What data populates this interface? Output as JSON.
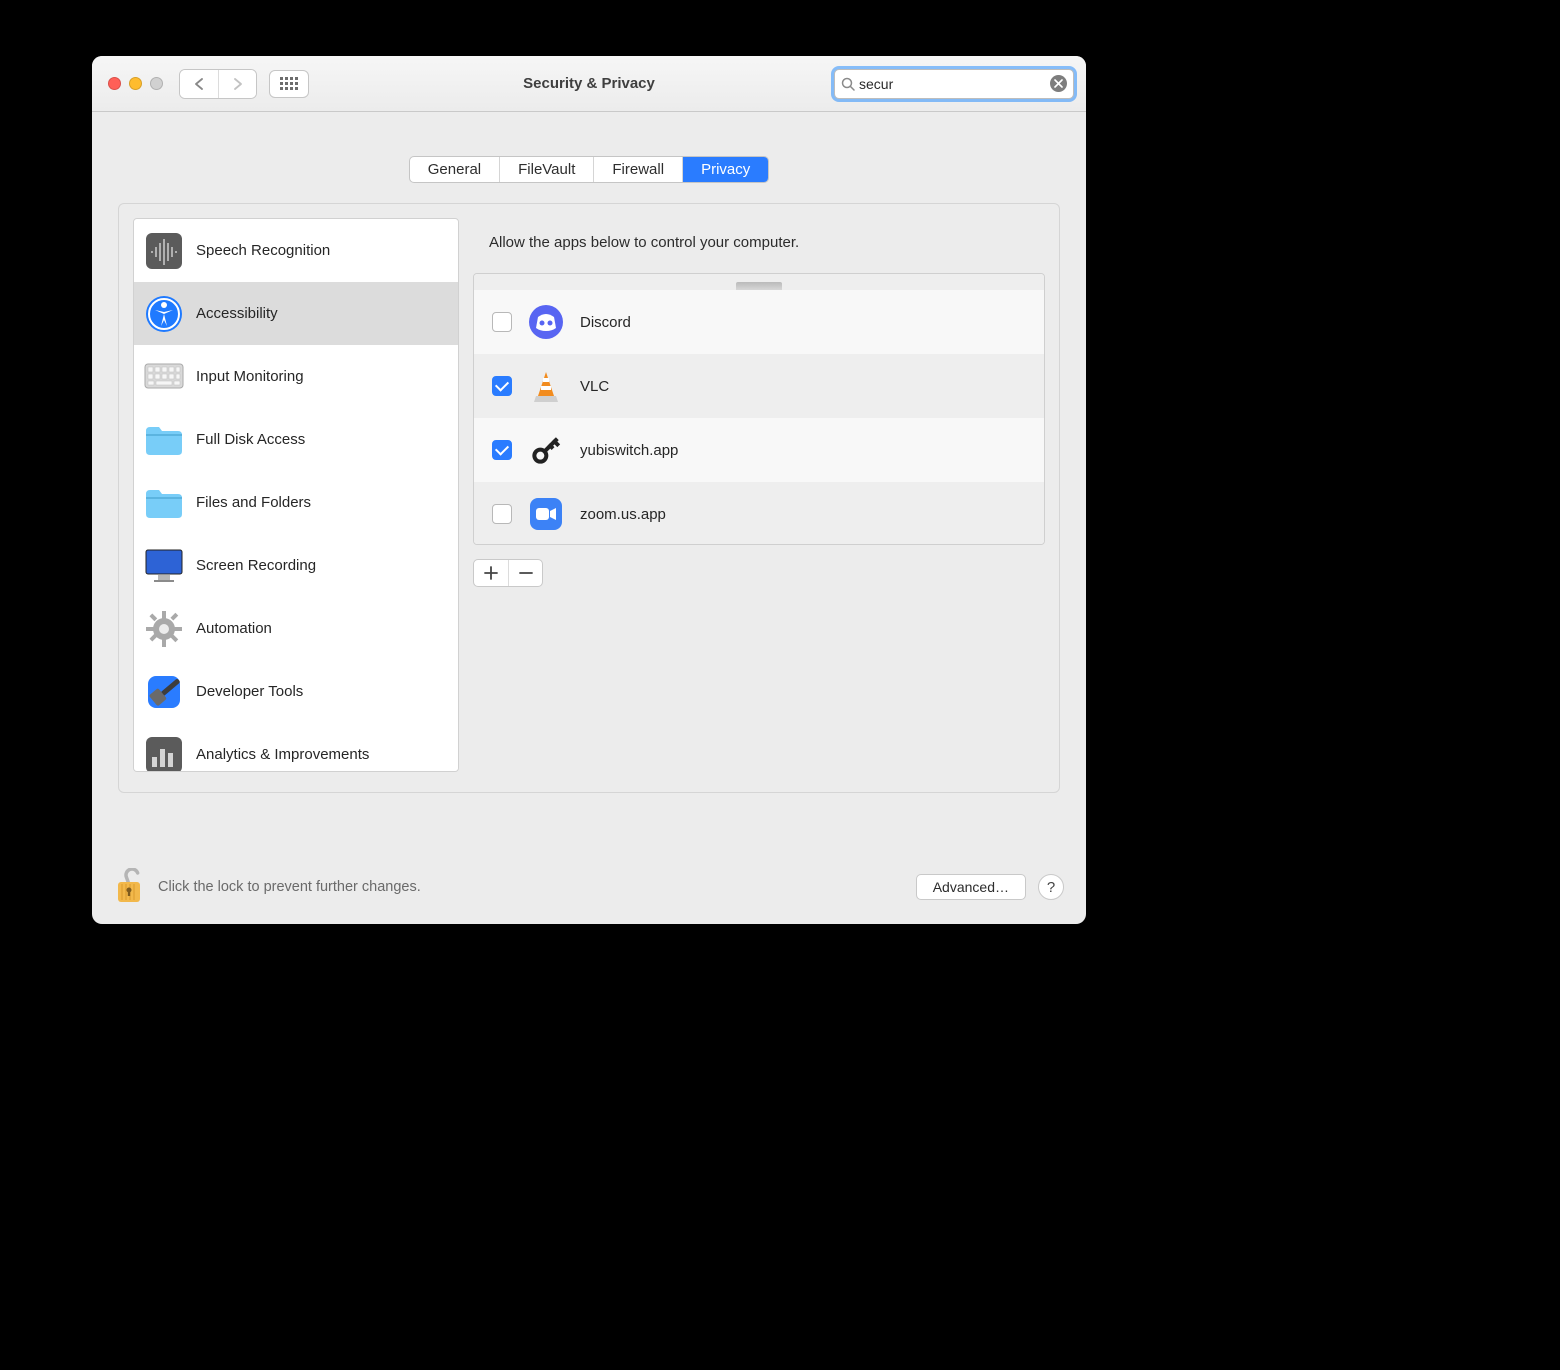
{
  "window": {
    "title": "Security & Privacy"
  },
  "search": {
    "value": "secur"
  },
  "tabs": [
    {
      "label": "General",
      "active": false
    },
    {
      "label": "FileVault",
      "active": false
    },
    {
      "label": "Firewall",
      "active": false
    },
    {
      "label": "Privacy",
      "active": true
    }
  ],
  "sidebar": {
    "items": [
      {
        "label": "Speech Recognition",
        "icon": "speech",
        "selected": false
      },
      {
        "label": "Accessibility",
        "icon": "accessibility",
        "selected": true
      },
      {
        "label": "Input Monitoring",
        "icon": "keyboard",
        "selected": false
      },
      {
        "label": "Full Disk Access",
        "icon": "folder",
        "selected": false
      },
      {
        "label": "Files and Folders",
        "icon": "folder",
        "selected": false
      },
      {
        "label": "Screen Recording",
        "icon": "screen",
        "selected": false
      },
      {
        "label": "Automation",
        "icon": "gear",
        "selected": false
      },
      {
        "label": "Developer Tools",
        "icon": "hammer",
        "selected": false
      },
      {
        "label": "Analytics & Improvements",
        "icon": "analytics",
        "selected": false
      }
    ]
  },
  "privacy": {
    "description": "Allow the apps below to control your computer.",
    "apps": [
      {
        "name": "Discord",
        "checked": false,
        "icon": "discord"
      },
      {
        "name": "VLC",
        "checked": true,
        "icon": "vlc"
      },
      {
        "name": "yubiswitch.app",
        "checked": true,
        "icon": "key"
      },
      {
        "name": "zoom.us.app",
        "checked": false,
        "icon": "zoom"
      }
    ]
  },
  "footer": {
    "lock_text": "Click the lock to prevent further changes.",
    "advanced_label": "Advanced…"
  }
}
